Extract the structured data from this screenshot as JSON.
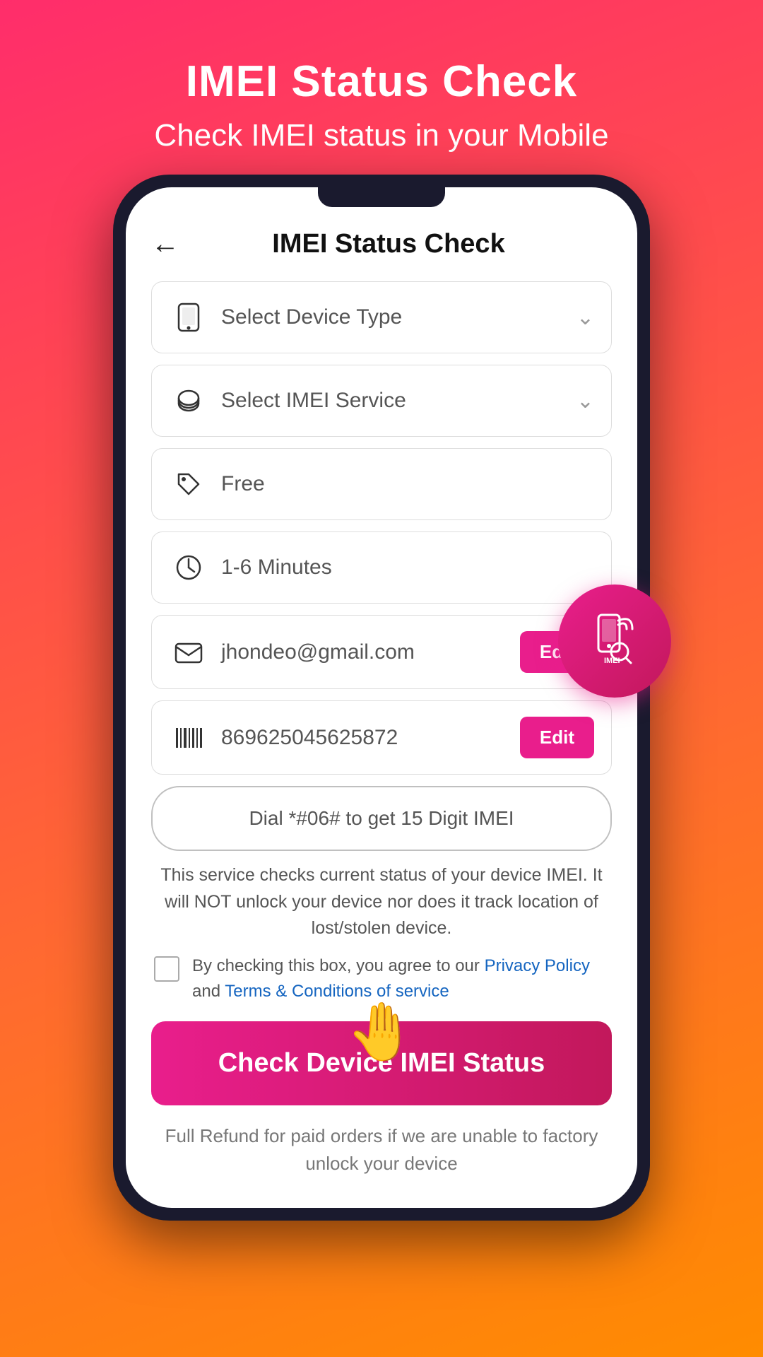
{
  "header": {
    "title": "IMEI Status Check",
    "subtitle": "Check IMEI status in your Mobile"
  },
  "appbar": {
    "back_label": "←",
    "title": "IMEI Status Check"
  },
  "form": {
    "device_type": {
      "placeholder": "Select Device Type",
      "icon": "phone-icon"
    },
    "imei_service": {
      "placeholder": "Select IMEI Service",
      "icon": "service-icon"
    },
    "price": {
      "value": "Free",
      "icon": "tag-icon"
    },
    "time": {
      "value": "1-6 Minutes",
      "icon": "clock-icon"
    },
    "email": {
      "value": "jhondeo@gmail.com",
      "edit_label": "Edit",
      "icon": "mail-icon"
    },
    "imei": {
      "value": "869625045625872",
      "edit_label": "Edit",
      "icon": "barcode-icon"
    }
  },
  "dial_button": {
    "label": "Dial *#06# to get 15 Digit IMEI"
  },
  "info_text": "This service checks current status of your device IMEI. It will NOT unlock your device nor does it track location of lost/stolen device.",
  "checkbox": {
    "label_prefix": "By checking this box, you agree to our ",
    "privacy_label": "Privacy Policy",
    "and_text": " and ",
    "terms_label": "Terms & Conditions of service"
  },
  "check_button": {
    "label": "Check Device IMEI Status"
  },
  "refund_text": "Full Refund for paid orders if we are unable to factory unlock your device",
  "imei_badge": {
    "label": "IMEI"
  }
}
